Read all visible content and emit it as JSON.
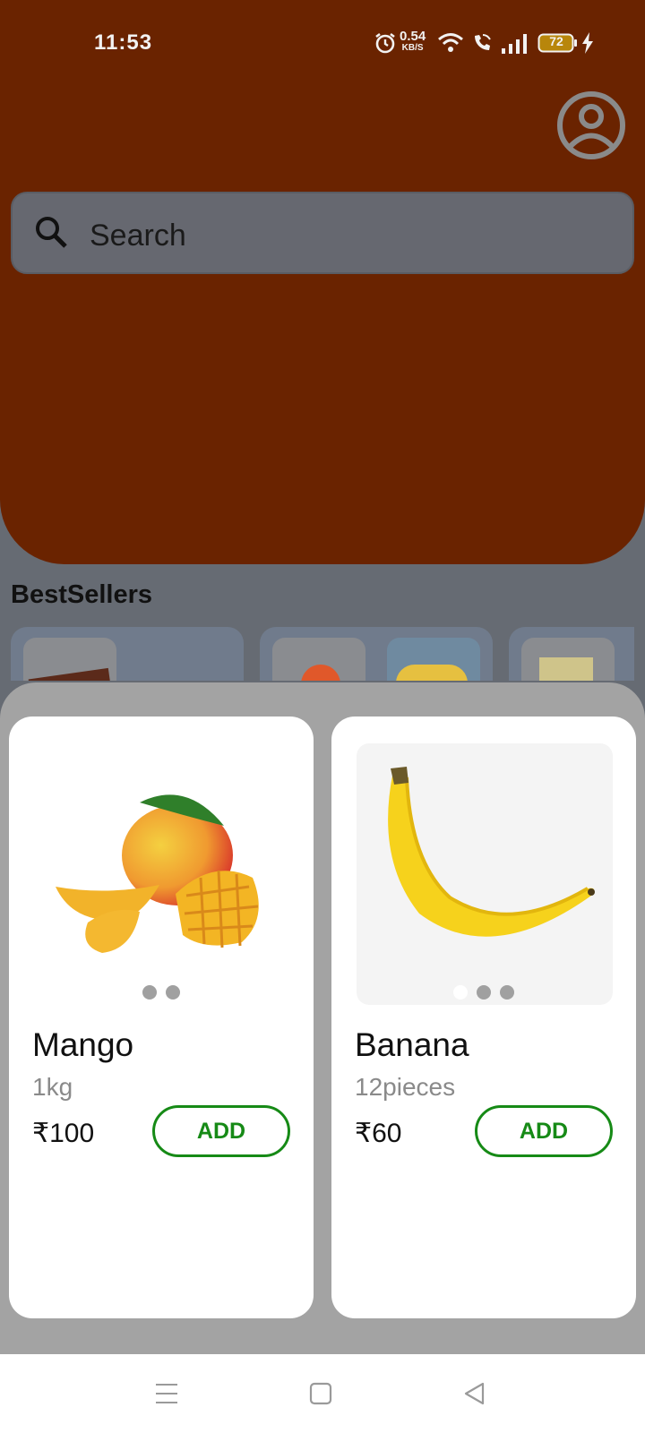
{
  "status_bar": {
    "time": "11:53",
    "net_speed_value": "0.54",
    "net_speed_unit": "KB/S",
    "battery": "72",
    "icons": [
      "alarm-icon",
      "wifi-icon",
      "wifi-call-icon",
      "signal-icon",
      "battery-icon",
      "charging-icon"
    ]
  },
  "header": {
    "profile_icon": "account-circle-icon",
    "color": "#6a2300"
  },
  "search": {
    "placeholder": "Search",
    "icon": "search-icon"
  },
  "bestsellers": {
    "title": "BestSellers"
  },
  "products": [
    {
      "name": "Mango",
      "quantity": "1kg",
      "price": "₹100",
      "add_label": "ADD",
      "image_count": 2,
      "active_image": 0
    },
    {
      "name": "Banana",
      "quantity": "12pieces",
      "price": "₹60",
      "add_label": "ADD",
      "image_count": 3,
      "active_image": 0
    }
  ],
  "accent_color": "#168a16",
  "nav": {
    "items": [
      "menu-icon",
      "home-square-icon",
      "back-triangle-icon"
    ]
  }
}
